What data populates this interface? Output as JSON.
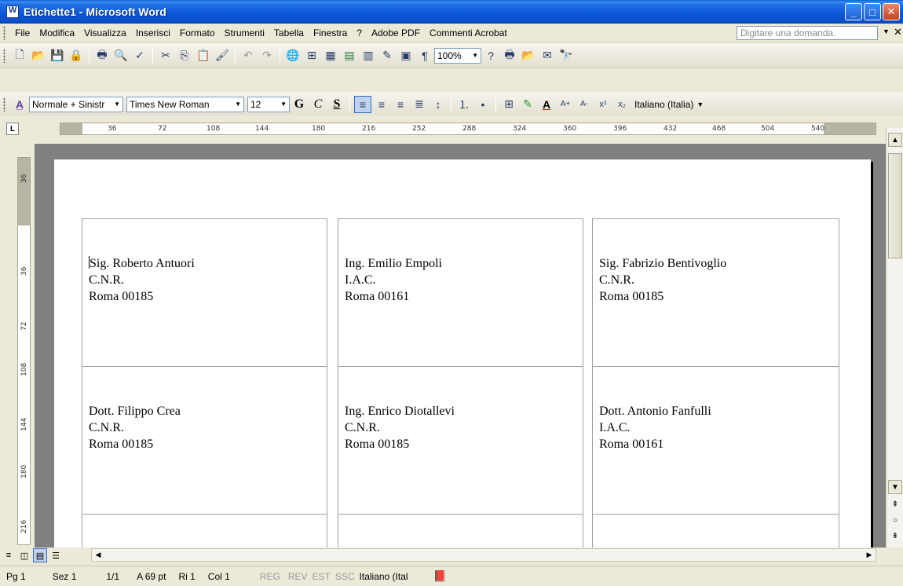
{
  "window": {
    "title": "Etichette1 - Microsoft Word"
  },
  "menu": {
    "items": [
      "File",
      "Modifica",
      "Visualizza",
      "Inserisci",
      "Formato",
      "Strumenti",
      "Tabella",
      "Finestra",
      "?",
      "Adobe PDF",
      "Commenti Acrobat"
    ],
    "help_placeholder": "Digitare una domanda."
  },
  "toolbar_standard": {
    "zoom": "100%"
  },
  "toolbar_format": {
    "style": "Normale + Sinistr",
    "font": "Times New Roman",
    "size": "12",
    "bold": "G",
    "italic": "C",
    "underline": "S",
    "language": "Italiano (Italia)"
  },
  "ruler": {
    "h_ticks": [
      "36",
      "72",
      "108",
      "144",
      "180",
      "216",
      "252",
      "288",
      "324",
      "360",
      "396",
      "432",
      "468",
      "504",
      "540"
    ],
    "v_ticks": [
      "36",
      "36",
      "72",
      "108",
      "144",
      "180",
      "216"
    ]
  },
  "labels": [
    {
      "line1": "Sig. Roberto Antuori",
      "line2": "C.N.R.",
      "line3": "Roma 00185"
    },
    {
      "line1": "Ing. Emilio Empoli",
      "line2": "I.A.C.",
      "line3": "Roma 00161"
    },
    {
      "line1": "Sig. Fabrizio Bentivoglio",
      "line2": "C.N.R.",
      "line3": "Roma 00185"
    },
    {
      "line1": "Dott. Filippo Crea",
      "line2": "C.N.R.",
      "line3": "Roma 00185"
    },
    {
      "line1": "Ing. Enrico Diotallevi",
      "line2": "C.N.R.",
      "line3": "Roma 00185"
    },
    {
      "line1": "Dott. Antonio Fanfulli",
      "line2": "I.A.C.",
      "line3": "Roma 00161"
    }
  ],
  "status": {
    "page": "Pg 1",
    "section": "Sez 1",
    "pages": "1/1",
    "at": "A 69 pt",
    "line": "Ri 1",
    "col": "Col 1",
    "reg": "REG",
    "rev": "REV",
    "est": "EST",
    "ssc": "SSC",
    "language": "Italiano (Ital"
  }
}
